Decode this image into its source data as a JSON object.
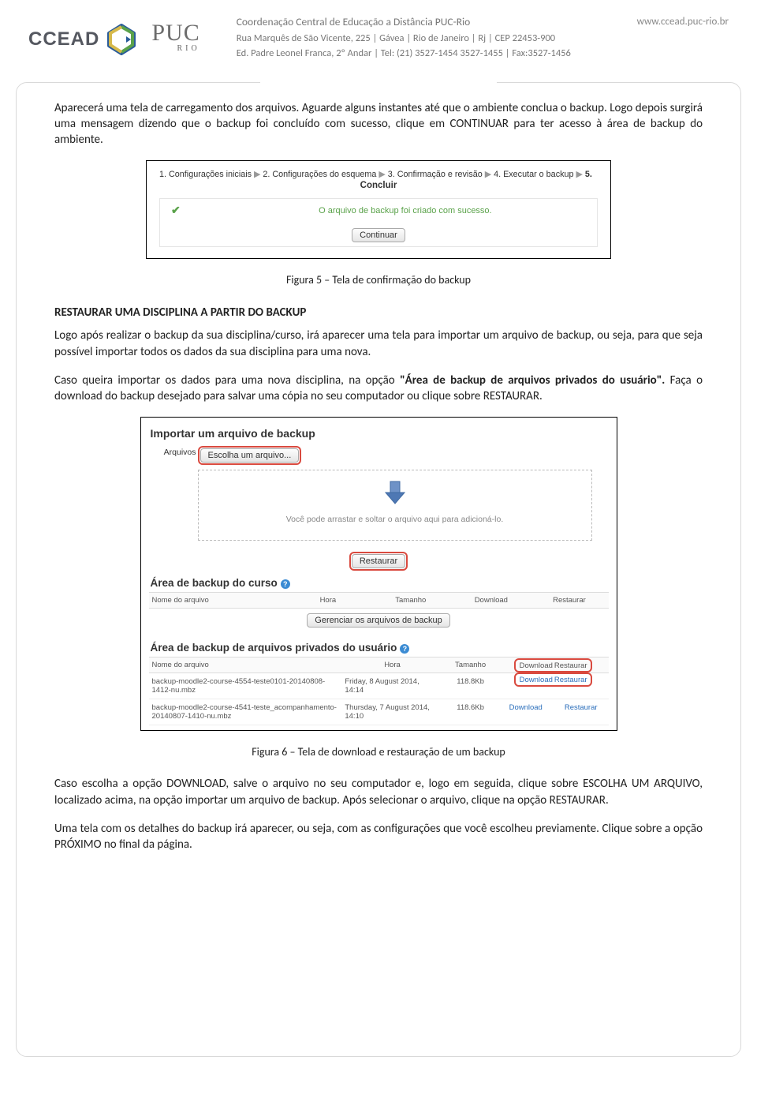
{
  "letterhead": {
    "brand_ccead": "CCEAD",
    "brand_puc": "PUC",
    "brand_puc_sub": "RIO",
    "title": "Coordenação Central de Educação a Distância PUC-Rio",
    "url": "www.ccead.puc-rio.br",
    "addr1": "Rua Marquês de São Vicente, 225  |  Gávea  |  Rio de Janeiro  |  Rj  |  CEP 22453-900",
    "addr2": "Ed. Padre Leonel Franca, 2º Andar  |  Tel: (21) 3527-1454   3527-1455  |  Fax:3527-1456"
  },
  "para1": "Aparecerá uma tela de carregamento dos arquivos. Aguarde alguns instantes até que o ambiente conclua o backup. Logo depois surgirá uma mensagem dizendo que o backup foi concluído com sucesso, clique em CONTINUAR para ter acesso à área de backup do ambiente.",
  "fig5": {
    "step1": "1. Configurações iniciais",
    "step2": "2. Configurações do esquema",
    "step3": "3. Confirmação e revisão",
    "step4": "4. Executar o backup",
    "step5": "5.",
    "step5b": "Concluir",
    "ok_msg": "O arquivo de backup foi criado com sucesso.",
    "btn_continuar": "Continuar",
    "caption": "Figura 5 – Tela de confirmação do backup"
  },
  "heading_restore": "RESTAURAR UMA DISCIPLINA A PARTIR DO BACKUP",
  "para2": "Logo após realizar o backup da sua disciplina/curso, irá aparecer uma tela para importar um arquivo de backup, ou seja, para que seja possível importar todos os dados da sua disciplina para uma nova.",
  "para3_a": "Caso queira importar os dados para uma nova disciplina, na opção ",
  "para3_b": "\"Área de backup de arquivos privados do usuário\".",
  "para3_c": " Faça o download do backup desejado para salvar uma cópia no seu computador ou clique sobre RESTAURAR.",
  "fig6": {
    "h_import": "Importar um arquivo de backup",
    "lbl_arquivos": "Arquivos",
    "btn_escolha": "Escolha um arquivo...",
    "drop_msg": "Você pode arrastar e soltar o arquivo aqui para adicioná-lo.",
    "btn_restaurar": "Restaurar",
    "h_area_curso": "Área de backup do curso",
    "th_nome": "Nome do arquivo",
    "th_hora": "Hora",
    "th_tamanho": "Tamanho",
    "th_download": "Download",
    "th_restaurar": "Restaurar",
    "btn_gerenciar": "Gerenciar os arquivos de backup",
    "h_area_user": "Área de backup de arquivos privados do usuário",
    "rows": [
      {
        "nome": "backup-moodle2-course-4554-teste0101-20140808-1412-nu.mbz",
        "hora": "Friday, 8 August 2014, 14:14",
        "tamanho": "118.8Kb",
        "download": "Download",
        "restaurar": "Restaurar"
      },
      {
        "nome": "backup-moodle2-course-4541-teste_acompanhamento-20140807-1410-nu.mbz",
        "hora": "Thursday, 7 August 2014, 14:10",
        "tamanho": "118.6Kb",
        "download": "Download",
        "restaurar": "Restaurar"
      }
    ],
    "caption": "Figura 6 – Tela de download e restauração de um backup"
  },
  "para4": "Caso escolha a opção DOWNLOAD, salve o arquivo no seu computador e, logo em seguida, clique sobre ESCOLHA UM ARQUIVO, localizado acima, na opção importar um arquivo de backup. Após selecionar o arquivo, clique na opção RESTAURAR.",
  "para5": "Uma tela com os detalhes do backup irá aparecer, ou seja, com as configurações que você escolheu previamente. Clique sobre a opção PRÓXIMO no final da página."
}
